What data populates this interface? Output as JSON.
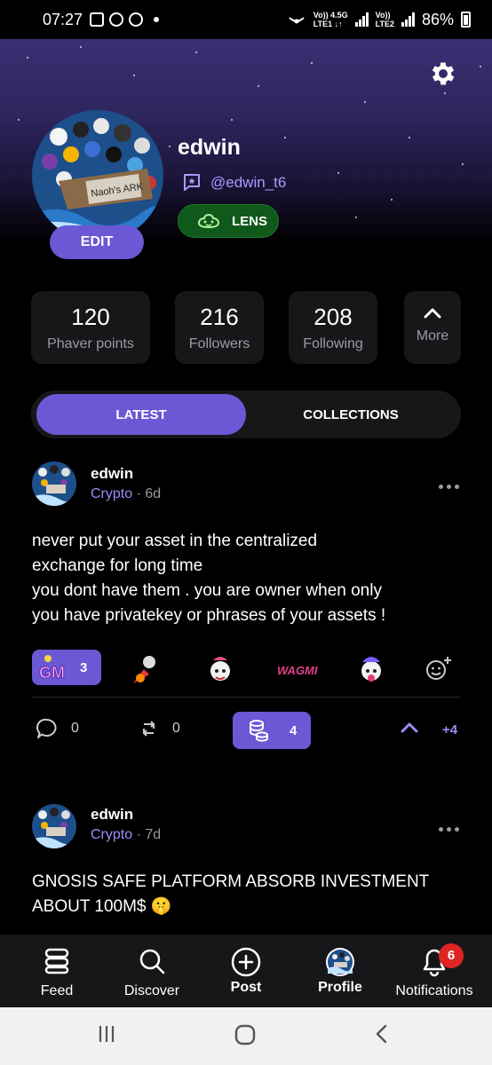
{
  "status_bar": {
    "time": "07:27",
    "network_top": "Vo)) 4.5G",
    "network_bottom": "LTE1 ↓↑",
    "network2_top": "Vo))",
    "network2_bottom": "LTE2",
    "battery": "86%"
  },
  "profile": {
    "name": "edwin",
    "handle": "@edwin_t6",
    "lens_label": "LENS",
    "edit_label": "EDIT",
    "avatar_text": "Naoh's ARK"
  },
  "stats": [
    {
      "value": "120",
      "label": "Phaver points"
    },
    {
      "value": "216",
      "label": "Followers"
    },
    {
      "value": "208",
      "label": "Following"
    }
  ],
  "more_label": "More",
  "tabs": [
    {
      "label": "LATEST",
      "active": true
    },
    {
      "label": "COLLECTIONS",
      "active": false
    }
  ],
  "posts": [
    {
      "author": "edwin",
      "category": "Crypto",
      "time": "· 6d",
      "lines": [
        "never put your asset in the centralized",
        "exchange for long time",
        "you dont have them . you are owner when only",
        "you have privatekey or phrases of your assets !"
      ],
      "reaction_count": "3",
      "reaction_label": "GM",
      "sticker_text": "WAGMI",
      "comments": "0",
      "reposts": "0",
      "coins": "4",
      "upvotes": "+4"
    },
    {
      "author": "edwin",
      "category": "Crypto",
      "time": "· 7d",
      "lines": [
        "GNOSIS SAFE PLATFORM ABSORB INVESTMENT",
        "ABOUT 100M$ 🤫"
      ]
    }
  ],
  "bottom_nav": [
    {
      "label": "Feed",
      "icon": "feed-icon"
    },
    {
      "label": "Discover",
      "icon": "search-icon"
    },
    {
      "label": "Post",
      "icon": "add-post-icon"
    },
    {
      "label": "Profile",
      "icon": "profile-avatar-icon",
      "active": true
    },
    {
      "label": "Notifications",
      "icon": "bell-icon"
    }
  ],
  "notification_count": "6",
  "colors": {
    "accent": "#6a58d4",
    "accent_text": "#9b8cf5",
    "lens_green": "#0f5a1a",
    "card": "#17171a",
    "badge_red": "#e02424"
  }
}
